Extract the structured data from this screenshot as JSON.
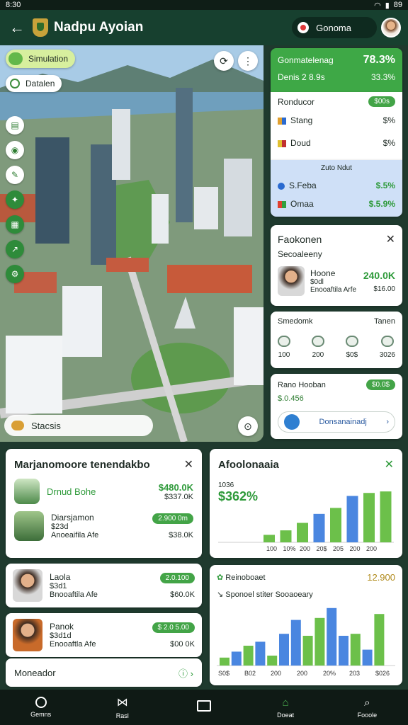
{
  "status": {
    "time": "8:30",
    "battery": "89"
  },
  "appbar": {
    "title": "Nadpu Ayoian",
    "location_chip": "Gonoma"
  },
  "map": {
    "pill_primary": "Simulation",
    "pill_secondary": "Datalen",
    "bottom_label": "Stacsis"
  },
  "card_summary": {
    "title": "Gonmatelenag",
    "value": "78.3%",
    "subtitle": "Denis 2 8.9s",
    "sub_value": "33.3%"
  },
  "card_rates": {
    "title": "Ronducor",
    "badge": "$00s",
    "rows": [
      {
        "label": "Stang",
        "value": "$%"
      },
      {
        "label": "Doud",
        "value": "$%"
      }
    ]
  },
  "card_blue": {
    "header": "Zuto Ndut",
    "rows": [
      {
        "label": "S.Feba",
        "value": "$.5%"
      },
      {
        "label": "Omaa",
        "value": "$.5.9%"
      }
    ]
  },
  "card_profile": {
    "title": "Faokonen",
    "subtitle": "Secoaleeny",
    "name": "Hoone",
    "line1": "$0dl",
    "line2": "Enooaftila Arfe",
    "value": "240.0K",
    "value2": "$16.00"
  },
  "card_stats": {
    "title": "Smedomk",
    "right": "Tanen",
    "items": [
      "100",
      "200",
      "$0$",
      "3026"
    ]
  },
  "card_nav": {
    "title": "Rano Hooban",
    "badge": "$0.0$",
    "value": "$.0.456",
    "button": "Donsanainadj"
  },
  "list_card": {
    "title": "Marjanomoore tenendakbo",
    "items": [
      {
        "name": "Drnud Bohe",
        "amount": "$480.0K",
        "sub": "$337.0K"
      },
      {
        "name": "Diarsjamon",
        "line1": "$23d",
        "line2": "Anoeaifila Afe",
        "badge": "2.900 0m",
        "amount": "$38.0K"
      }
    ]
  },
  "item_cards": [
    {
      "name": "Laola",
      "line1": "$3d1",
      "line2": "Bnooaftila Afe",
      "badge": "2.0.100",
      "amount": "$60.0K"
    },
    {
      "name": "Panok",
      "line1": "$3d1d",
      "line2": "Enooaftla Afe",
      "badge": "$ 2.0 5.00",
      "amount": "$00 0K"
    }
  ],
  "footer_card": {
    "label": "Moneador"
  },
  "chart1": {
    "title": "Afoolonaaia",
    "subtitle": "1036",
    "value": "$362%",
    "chart_data": {
      "type": "bar",
      "categories": [
        "100",
        "10%",
        "200",
        "206",
        "200",
        "200",
        "200"
      ],
      "series": [
        {
          "values": [
            10,
            16,
            26,
            38,
            46,
            62,
            66
          ]
        }
      ],
      "colors": [
        "#6cc04a",
        "#6cc04a",
        "#6cc04a",
        "#4a86e0",
        "#6cc04a",
        "#4a86e0",
        "#6cc04a",
        "#6cc04a"
      ],
      "raw": [
        10,
        16,
        26,
        38,
        46,
        62,
        66,
        68
      ],
      "tick_labels": [
        "100",
        "10%",
        "200",
        "20$",
        "205",
        "200",
        "200"
      ]
    }
  },
  "chart2": {
    "title": "Reinoboaet",
    "value": "12.900",
    "subtitle": "Sponoel stiter Sooaoeary",
    "chart_data": {
      "type": "bar",
      "categories": [
        "S0$",
        "B02",
        "200",
        "200",
        "20%",
        "203",
        "$026"
      ],
      "bars": [
        {
          "v": 8,
          "c": "#6cc04a"
        },
        {
          "v": 14,
          "c": "#4a86e0"
        },
        {
          "v": 20,
          "c": "#6cc04a"
        },
        {
          "v": 24,
          "c": "#4a86e0"
        },
        {
          "v": 10,
          "c": "#6cc04a"
        },
        {
          "v": 32,
          "c": "#4a86e0"
        },
        {
          "v": 46,
          "c": "#4a86e0"
        },
        {
          "v": 30,
          "c": "#6cc04a"
        },
        {
          "v": 48,
          "c": "#6cc04a"
        },
        {
          "v": 58,
          "c": "#4a86e0"
        },
        {
          "v": 30,
          "c": "#4a86e0"
        },
        {
          "v": 32,
          "c": "#6cc04a"
        },
        {
          "v": 16,
          "c": "#4a86e0"
        },
        {
          "v": 52,
          "c": "#6cc04a"
        }
      ]
    }
  },
  "bottomnav": [
    "Gemns",
    "Rasl",
    "",
    "Doeat",
    "Fooole"
  ]
}
